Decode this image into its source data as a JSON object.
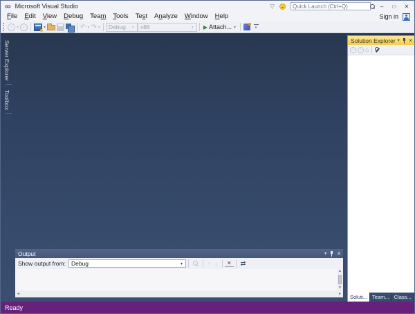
{
  "titlebar": {
    "title": "Microsoft Visual Studio",
    "quick_launch_placeholder": "Quick Launch (Ctrl+Q)"
  },
  "account": {
    "sign_in": "Sign in"
  },
  "menu": {
    "items": [
      {
        "label": "File",
        "u": 0
      },
      {
        "label": "Edit",
        "u": 0
      },
      {
        "label": "View",
        "u": 0
      },
      {
        "label": "Debug",
        "u": 0
      },
      {
        "label": "Team",
        "u": 3
      },
      {
        "label": "Tools",
        "u": 0
      },
      {
        "label": "Test",
        "u": 2
      },
      {
        "label": "Analyze",
        "u": 1
      },
      {
        "label": "Window",
        "u": 0
      },
      {
        "label": "Help",
        "u": 0
      }
    ]
  },
  "toolbar": {
    "debug_combo": "Debug",
    "platform_combo": "x86",
    "attach_label": "Attach..."
  },
  "left_dock": {
    "tabs": [
      "Server Explorer",
      "Toolbox"
    ]
  },
  "solution_explorer": {
    "title": "Solution Explorer",
    "bottom_tabs": [
      {
        "label": "Soluti...",
        "active": true
      },
      {
        "label": "Team...",
        "active": false
      },
      {
        "label": "Class...",
        "active": false
      }
    ]
  },
  "output_panel": {
    "title": "Output",
    "show_output_label": "Show output from:",
    "selected_source": "Debug"
  },
  "statusbar": {
    "text": "Ready"
  },
  "colors": {
    "status_purple": "#68217a",
    "active_panel_gold": "#f5cd4c",
    "attach_green": "#2d8a2d",
    "logo_purple": "#7a2f8f"
  },
  "icons": {
    "dropdown": "▾",
    "back": "‹",
    "forward": "›",
    "undo": "↶",
    "redo": "↷",
    "play": "▶",
    "home": "⌂",
    "close": "✕",
    "minimize": "–",
    "maximize": "□",
    "filter": "▽",
    "up": "▲",
    "down": "▼",
    "left": "◄",
    "right": "►",
    "clear": "✕",
    "wordwrap": "⇄",
    "prev_msg": "↑",
    "next_msg": "↓",
    "logo": "∞"
  }
}
